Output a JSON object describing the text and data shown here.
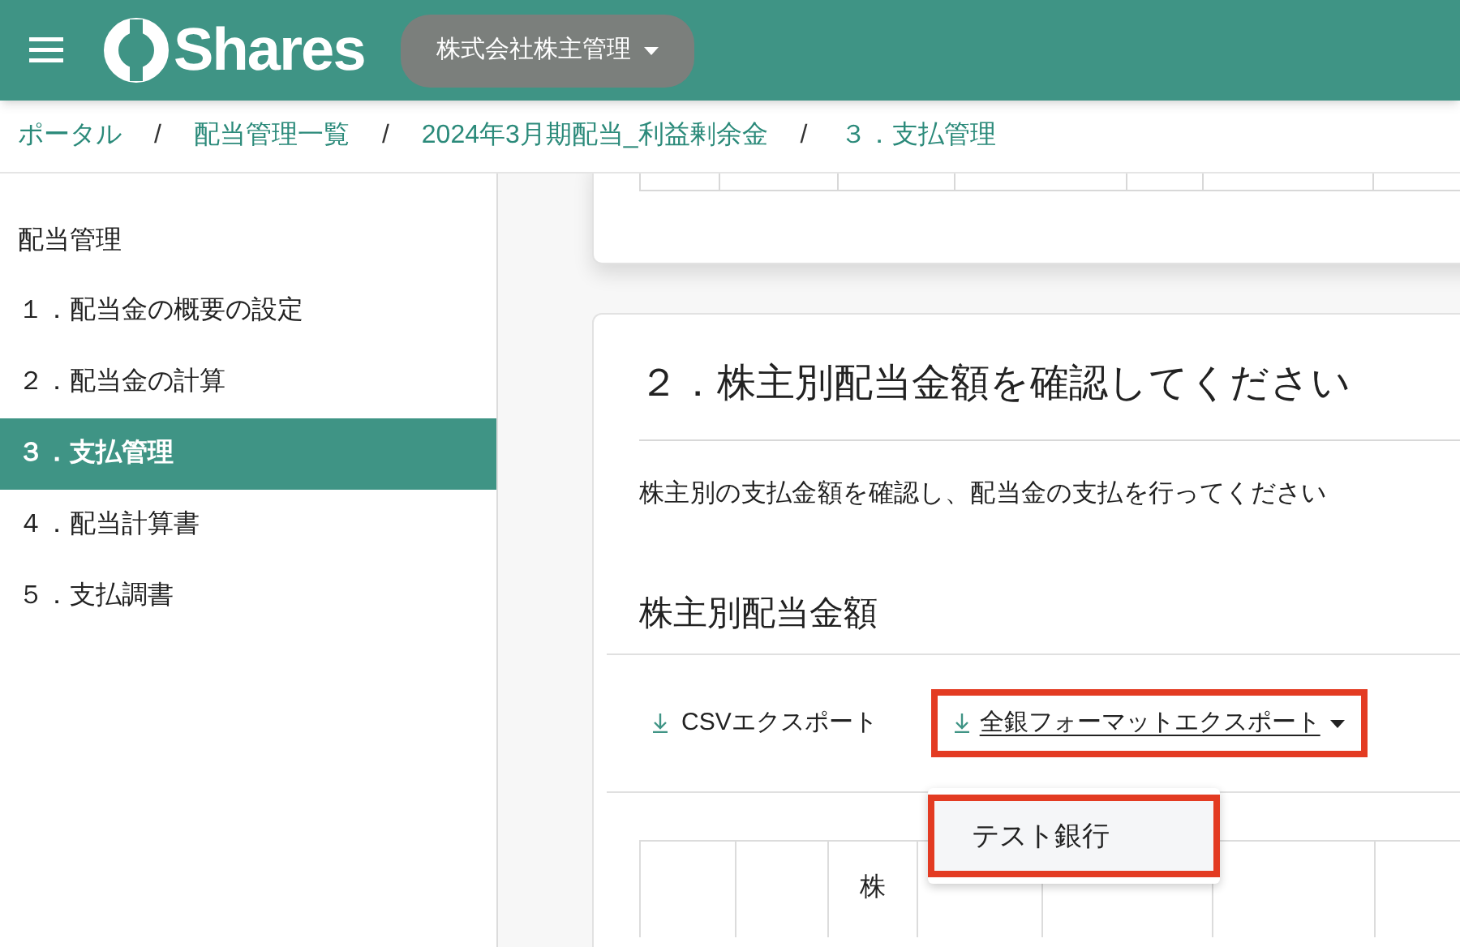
{
  "header": {
    "logo": "Shares",
    "company": "株式会社株主管理"
  },
  "breadcrumb_separator": "/",
  "breadcrumbs": [
    "ポータル",
    "配当管理一覧",
    "2024年3月期配当_利益剰余金",
    "３．支払管理"
  ],
  "sidebar": {
    "heading": "配当管理",
    "items": [
      {
        "label": "１．配当金の概要の設定",
        "selected": false
      },
      {
        "label": "２．配当金の計算",
        "selected": false
      },
      {
        "label": "３．支払管理",
        "selected": true
      },
      {
        "label": "４．配当計算書",
        "selected": false
      },
      {
        "label": "５．支払調書",
        "selected": false
      }
    ]
  },
  "section": {
    "title": "２．株主別配当金額を確認してください",
    "description": "株主別の支払金額を確認し、配当金の支払を行ってください",
    "subheading": "株主別配当金額",
    "exports": [
      {
        "label": "CSVエクスポート",
        "kind": "link",
        "highlighted": false
      },
      {
        "label": "全銀フォーマットエクスポート",
        "kind": "dropdown",
        "highlighted": true
      }
    ],
    "dropdown_items": [
      {
        "label": "テスト銀行",
        "highlighted": true
      }
    ],
    "table": {
      "column_3": "株"
    }
  }
}
